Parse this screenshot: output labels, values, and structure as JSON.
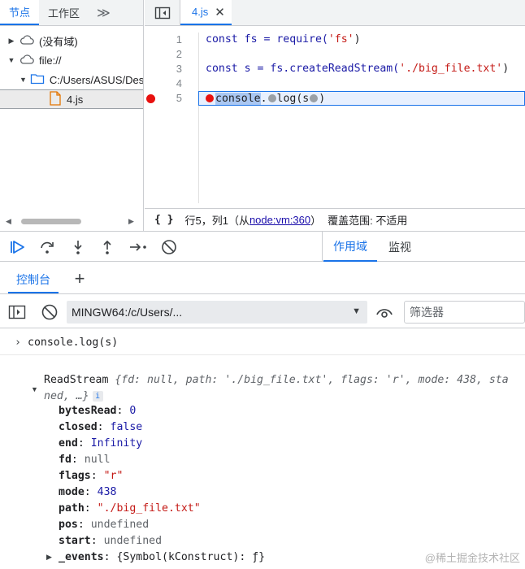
{
  "navigator": {
    "tabs": [
      "节点",
      "工作区"
    ],
    "more_glyph": "≫",
    "tree": [
      {
        "label": "(没有域)",
        "expanded": false,
        "icon": "cloud-icon"
      },
      {
        "label": "file://",
        "expanded": true,
        "icon": "cloud-icon"
      },
      {
        "label": "C:/Users/ASUS/Deskt",
        "expanded": true,
        "icon": "folder-icon"
      },
      {
        "label": "4.js",
        "selected": true,
        "icon": "file-icon"
      }
    ]
  },
  "editor": {
    "tab_label": "4.js",
    "lines": [
      {
        "num": "1"
      },
      {
        "num": "2"
      },
      {
        "num": "3"
      },
      {
        "num": "4"
      },
      {
        "num": "5"
      }
    ],
    "code": {
      "l1_a": "const fs = require(",
      "l1_b": "'fs'",
      "l1_c": ")",
      "l3_a": "const s = fs.createReadStream(",
      "l3_b": "'./big_file.txt'",
      "l3_c": ")",
      "l5_a": "console",
      "l5_b": ".",
      "l5_c": "log(s",
      "l5_d": ")"
    },
    "status": {
      "braces": "{ }",
      "position": "行5，列1（从",
      "link": "node:vm:360",
      "close": "）",
      "coverage": "覆盖范围: 不适用"
    }
  },
  "debugger": {
    "tabs": [
      "作用域",
      "监视"
    ]
  },
  "drawer": {
    "tab_label": "控制台",
    "add_glyph": "+"
  },
  "console_toolbar": {
    "context": "MINGW64:/c/Users/...",
    "filter_placeholder": "筛选器"
  },
  "console": {
    "input_prompt": "›",
    "input_text": "console.log(s)",
    "object_line1_class": "ReadStream ",
    "object_line1_rest": "{fd: null, path: './big_file.txt', flags: 'r', mode: 438, sta",
    "object_line2": "ned, …}",
    "info_badge": "i",
    "properties": [
      {
        "key": "bytesRead",
        "value": "0",
        "kind": "num"
      },
      {
        "key": "closed",
        "value": "false",
        "kind": "kw"
      },
      {
        "key": "end",
        "value": "Infinity",
        "kind": "kw"
      },
      {
        "key": "fd",
        "value": "null",
        "kind": "null"
      },
      {
        "key": "flags",
        "value": "\"r\"",
        "kind": "str"
      },
      {
        "key": "mode",
        "value": "438",
        "kind": "num"
      },
      {
        "key": "path",
        "value": "\"./big_file.txt\"",
        "kind": "str"
      },
      {
        "key": "pos",
        "value": "undefined",
        "kind": "null"
      },
      {
        "key": "start",
        "value": "undefined",
        "kind": "null"
      },
      {
        "key": "_events",
        "value": "{Symbol(kConstruct): ƒ}",
        "kind": "text"
      }
    ]
  },
  "watermark": "@稀土掘金技术社区",
  "colors": {
    "accent": "#1a73e8",
    "breakpoint": "#e8110f",
    "string": "#c41a16",
    "keyword": "#1a1aa6"
  }
}
